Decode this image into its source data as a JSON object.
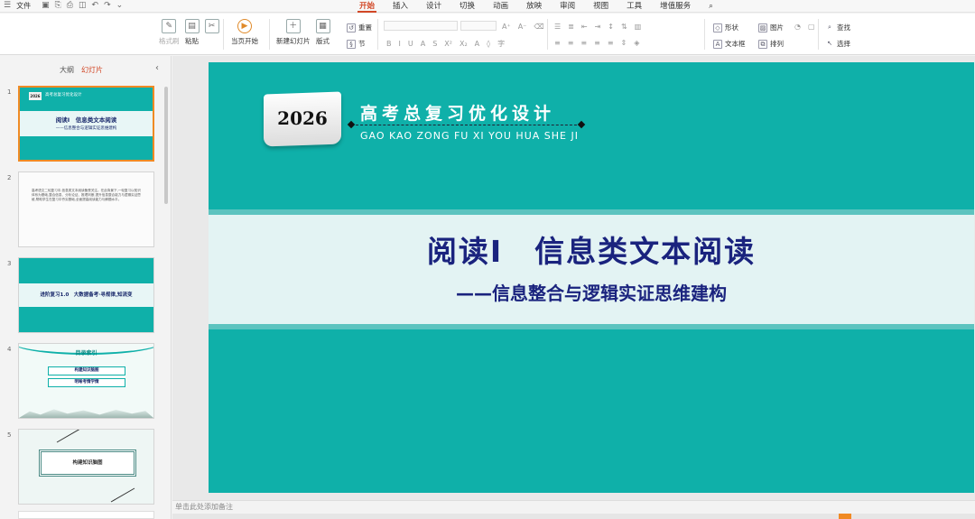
{
  "menubar": {
    "file_label": "文件",
    "tabs": [
      {
        "label": "开始",
        "active": true
      },
      {
        "label": "插入"
      },
      {
        "label": "设计"
      },
      {
        "label": "切换"
      },
      {
        "label": "动画"
      },
      {
        "label": "放映"
      },
      {
        "label": "审阅"
      },
      {
        "label": "视图"
      },
      {
        "label": "工具"
      },
      {
        "label": "增值服务"
      }
    ],
    "accent_color": "#d24726"
  },
  "ribbon": {
    "format_painter": "格式刷",
    "paste": "粘贴",
    "start_from_current": "当页开始",
    "new_slide": "新建幻灯片",
    "layout": "版式",
    "section": "节",
    "reset": "重置",
    "shape": "形状",
    "picture": "图片",
    "textbox": "文本框",
    "arrange": "排列",
    "find": "查找",
    "select": "选择"
  },
  "left_panel": {
    "tab_outline": "大纲",
    "tab_slides": "幻灯片",
    "thumbs": [
      {
        "num": "1",
        "year": "2026",
        "title": "阅读Ⅰ　信息类文本阅读",
        "subtitle": "——信息整合与逻辑实证思维建构"
      },
      {
        "num": "2",
        "text": "高考语文二轮复习中,信息类文本阅读备受关注。在此背景下,一轮复习以知识体系为基础,整合信息、分析论证、推理判断,提升信息整合能力与逻辑实证思维,帮助学生在复习中夯实基础,全面提高阅读能力与解题水平。"
      },
      {
        "num": "3",
        "text": "进阶复习1.0　大数据备考·寻规律,知流变"
      },
      {
        "num": "4",
        "title": "目录索引",
        "item1": "构建知识脑图",
        "item2": "明晰考情学情"
      },
      {
        "num": "5",
        "text": "构建知识脑图"
      }
    ]
  },
  "slide": {
    "year": "2026",
    "header_title": "高考总复习优化设计",
    "header_pinyin": "GAO KAO ZONG FU XI YOU HUA SHE JI",
    "main_title": "阅读Ⅰ　信息类文本阅读",
    "subtitle": "——信息整合与逻辑实证思维建构",
    "bg_color": "#0fb0a9",
    "title_color": "#1a237e"
  },
  "notes_placeholder": "单击此处添加备注"
}
